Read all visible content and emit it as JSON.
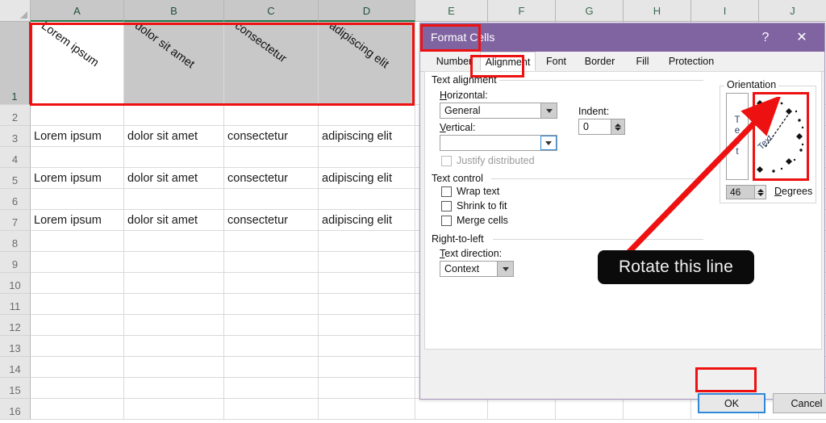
{
  "spreadsheet": {
    "columns": [
      "A",
      "B",
      "C",
      "D",
      "E",
      "F",
      "G",
      "H",
      "I",
      "J"
    ],
    "rows": [
      "1",
      "2",
      "3",
      "4",
      "5",
      "6",
      "7",
      "8",
      "9",
      "10",
      "11",
      "12",
      "13",
      "14",
      "15",
      "16"
    ],
    "header_row_values": [
      "Lorem ipsum",
      "dolor sit amet",
      "consectetur",
      "adipiscing elit"
    ],
    "data_rows": [
      {
        "row": "3",
        "cells": [
          "Lorem ipsum",
          "dolor sit amet",
          "consectetur",
          "adipiscing elit"
        ]
      },
      {
        "row": "5",
        "cells": [
          "Lorem ipsum",
          "dolor sit amet",
          "consectetur",
          "adipiscing elit"
        ]
      },
      {
        "row": "7",
        "cells": [
          "Lorem ipsum",
          "dolor sit amet",
          "consectetur",
          "adipiscing elit"
        ]
      }
    ],
    "selected_columns": [
      "A",
      "B",
      "C",
      "D"
    ],
    "selected_row": "1",
    "header_rotation_degrees": -36
  },
  "dialog": {
    "title": "Format Cells",
    "help_icon": "question-mark",
    "close_icon": "close-x",
    "tabs": [
      {
        "label": "Number",
        "active": false
      },
      {
        "label": "Alignment",
        "active": true
      },
      {
        "label": "Font",
        "active": false
      },
      {
        "label": "Border",
        "active": false
      },
      {
        "label": "Fill",
        "active": false
      },
      {
        "label": "Protection",
        "active": false
      }
    ],
    "text_alignment": {
      "group_label": "Text alignment",
      "horizontal_label": "Horizontal:",
      "horizontal_value": "General",
      "vertical_label": "Vertical:",
      "vertical_value": "",
      "indent_label": "Indent:",
      "indent_value": "0",
      "justify_distributed_label": "Justify distributed",
      "justify_distributed_checked": false,
      "justify_distributed_disabled": true
    },
    "text_control": {
      "group_label": "Text control",
      "items": [
        {
          "label": "Wrap text",
          "checked": false
        },
        {
          "label": "Shrink to fit",
          "checked": false
        },
        {
          "label": "Merge cells",
          "checked": false
        }
      ]
    },
    "right_to_left": {
      "group_label": "Right-to-left",
      "text_direction_label": "Text direction:",
      "text_direction_value": "Context"
    },
    "orientation": {
      "group_label": "Orientation",
      "vertical_preview_text": "Text",
      "dial_sample_text": "Text",
      "degrees_value": "46",
      "degrees_label": "Degrees"
    },
    "footer": {
      "ok_label": "OK",
      "cancel_label": "Cancel"
    }
  },
  "annotation": {
    "callout_text": "Rotate this line",
    "highlight_color": "#ee1111",
    "callout_bg": "#0b0b0b",
    "accent_color": "#8064a2",
    "focus_color": "#2e8ad8"
  }
}
